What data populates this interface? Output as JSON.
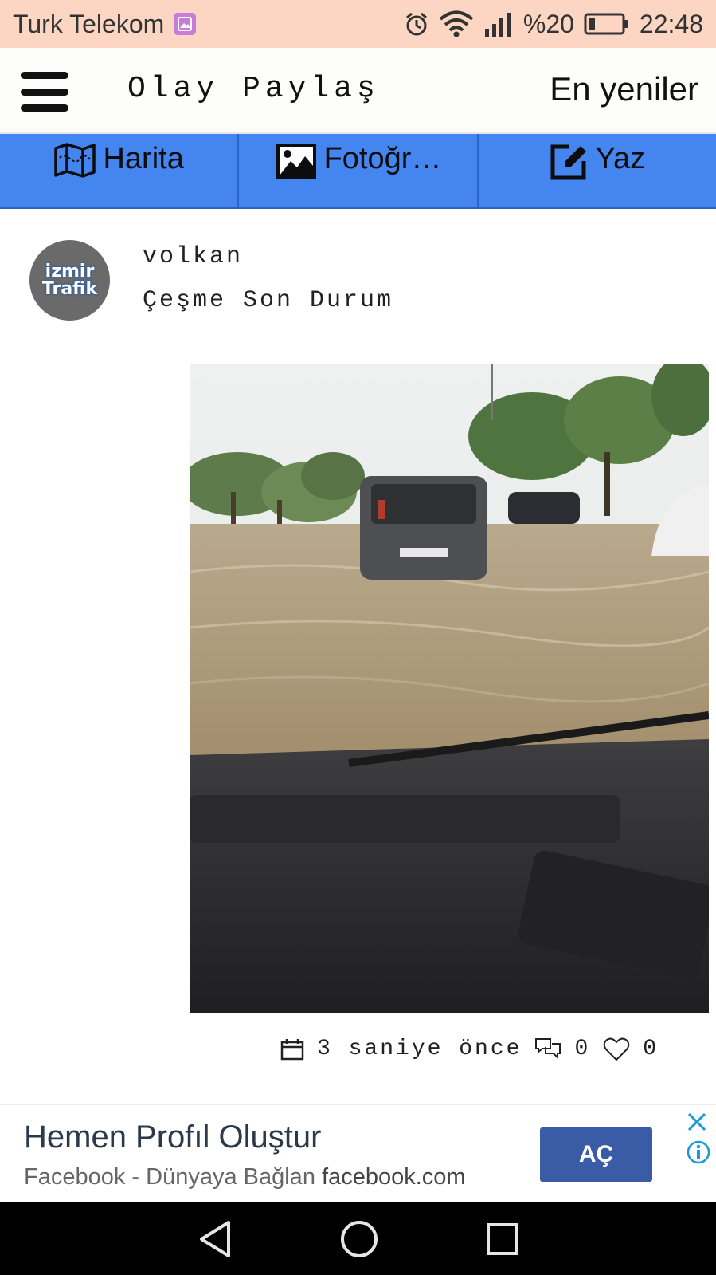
{
  "status_bar": {
    "carrier": "Turk Telekom",
    "battery_text": "%20",
    "time": "22:48",
    "battery_level": 0.2,
    "icons": [
      "gallery-icon",
      "alarm-icon",
      "wifi-icon",
      "signal-icon",
      "battery-icon"
    ]
  },
  "header": {
    "title": "Olay Paylaş",
    "sort_label": "En yeniler",
    "menu_icon": "hamburger-menu-icon"
  },
  "tabs": [
    {
      "label": "Harita",
      "icon": "map-icon"
    },
    {
      "label": "Fotoğr…",
      "icon": "image-icon"
    },
    {
      "label": "Yaz",
      "icon": "edit-icon"
    }
  ],
  "post": {
    "avatar_text": {
      "line1": "izmir",
      "line2": "Trafik"
    },
    "username": "volkan",
    "title": "Çeşme Son Durum",
    "time_ago": "3 saniye önce",
    "comments": "0",
    "likes": "0"
  },
  "ad": {
    "title": "Hemen Profıl Oluştur",
    "subtitle": "Facebook - Dünyaya Bağlan",
    "domain": "facebook.com",
    "button_label": "AÇ",
    "button_color": "#3a5ba5"
  },
  "colors": {
    "status_bar_bg": "#fcd6c2",
    "tab_bar_bg": "#4485f0"
  }
}
